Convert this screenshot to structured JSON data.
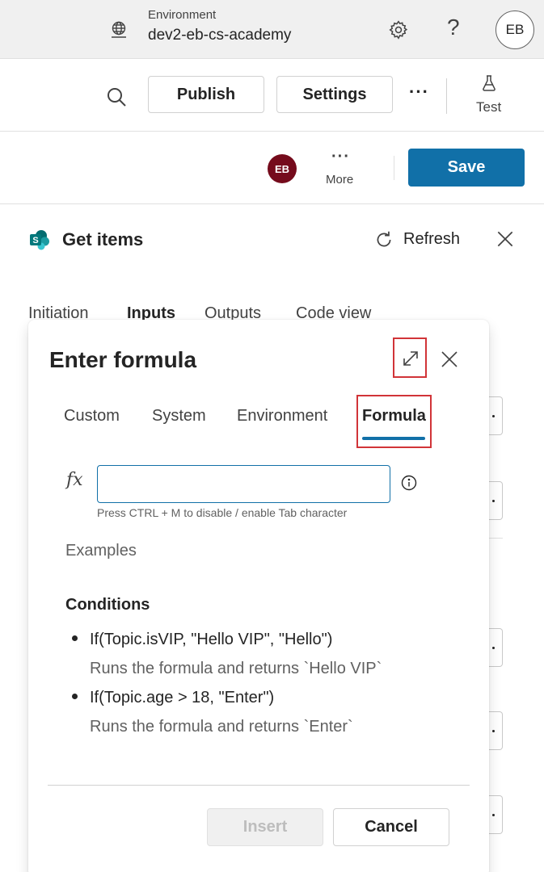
{
  "environment": {
    "label": "Environment",
    "name": "dev2-eb-cs-academy",
    "user_initials": "EB"
  },
  "toolbar": {
    "publish_label": "Publish",
    "settings_label": "Settings",
    "more_label": "···",
    "test_label": "Test"
  },
  "editor_bar": {
    "avatar_initials": "EB",
    "more_dots": "···",
    "more_label": "More",
    "save_label": "Save",
    "save_color": "#1170a8"
  },
  "panel": {
    "title": "Get items",
    "refresh_label": "Refresh",
    "tabs": [
      {
        "label": "Initiation"
      },
      {
        "label": "Inputs"
      },
      {
        "label": "Outputs"
      },
      {
        "label": "Code view"
      }
    ],
    "active_tab": "Inputs"
  },
  "modal": {
    "title": "Enter formula",
    "tabs": [
      {
        "label": "Custom"
      },
      {
        "label": "System"
      },
      {
        "label": "Environment"
      },
      {
        "label": "Formula"
      }
    ],
    "active_tab": "Formula",
    "fx_label": "fx",
    "formula_value": "",
    "hint": "Press CTRL + M to disable / enable Tab character",
    "examples_label": "Examples",
    "conditions_heading": "Conditions",
    "examples": [
      {
        "code": "If(Topic.isVIP, \"Hello VIP\", \"Hello\")",
        "description": "Runs the formula and returns `Hello VIP`"
      },
      {
        "code": "If(Topic.age > 18, \"Enter\")",
        "description": "Runs the formula and returns `Enter`"
      }
    ],
    "insert_label": "Insert",
    "cancel_label": "Cancel",
    "highlight_color": "#d13438"
  }
}
